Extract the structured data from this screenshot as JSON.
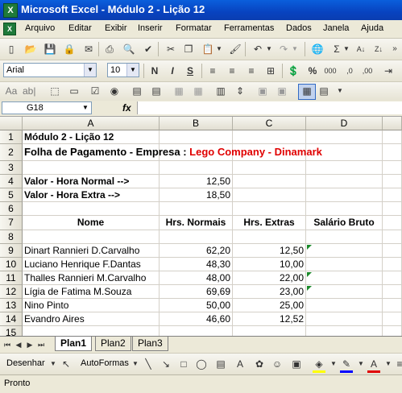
{
  "window": {
    "title": "Microsoft Excel - Módulo 2 - Lição 12",
    "app_icon": "X"
  },
  "menu": {
    "items": [
      "Arquivo",
      "Editar",
      "Exibir",
      "Inserir",
      "Formatar",
      "Ferramentas",
      "Dados",
      "Janela",
      "Ajuda"
    ]
  },
  "toolbar_format": {
    "font": "Arial",
    "size": "10",
    "bold": "N",
    "italic": "I",
    "underline": "S",
    "percent": "%",
    "thousands": "000"
  },
  "formula_bar": {
    "cell_ref": "G18",
    "fx": "fx",
    "content": ""
  },
  "columns": [
    "A",
    "B",
    "C",
    "D"
  ],
  "rows": [
    "1",
    "2",
    "3",
    "4",
    "5",
    "6",
    "7",
    "8",
    "9",
    "10",
    "11",
    "12",
    "13",
    "14",
    "15"
  ],
  "sheet": {
    "a1": "Módulo 2 - Lição 12",
    "a2_prefix": "Folha de Pagamento - Empresa : ",
    "a2_company": "Lego Company - Dinamark",
    "a4": "Valor - Hora Normal -->",
    "b4": "12,50",
    "a5": "Valor - Hora Extra -->",
    "b5": "18,50",
    "headers": {
      "nome": "Nome",
      "normais": "Hrs. Normais",
      "extras": "Hrs. Extras",
      "bruto": "Salário Bruto"
    },
    "employees": [
      {
        "nome": "Dinart Rannieri D.Carvalho",
        "normais": "62,20",
        "extras": "12,50"
      },
      {
        "nome": "Luciano Henrique F.Dantas",
        "normais": "48,30",
        "extras": "10,00"
      },
      {
        "nome": "Thalles Rannieri M.Carvalho",
        "normais": "48,00",
        "extras": "22,00"
      },
      {
        "nome": "Lígia de Fatima M.Souza",
        "normais": "69,69",
        "extras": "23,00"
      },
      {
        "nome": "Nino Pinto",
        "normais": "50,00",
        "extras": "25,00"
      },
      {
        "nome": "Evandro Aires",
        "normais": "46,60",
        "extras": "12,52"
      }
    ]
  },
  "sheet_tabs": [
    "Plan1",
    "Plan2",
    "Plan3"
  ],
  "drawing": {
    "draw_label": "Desenhar",
    "autoshapes_label": "AutoFormas"
  },
  "status": {
    "text": "Pronto"
  },
  "colors": {
    "title_bar": "#0a5fdc",
    "company_text": "#e00000",
    "excel_green": "#1f7a3b"
  }
}
